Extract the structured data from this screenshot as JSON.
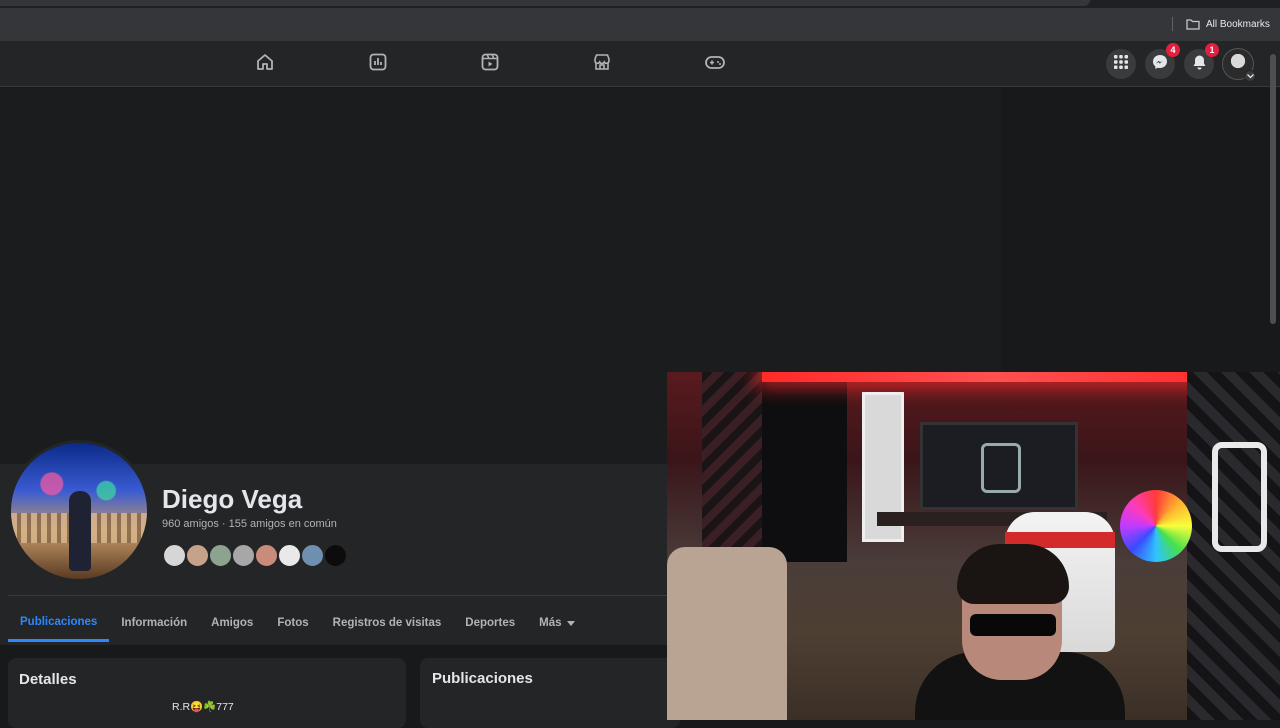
{
  "browser": {
    "bookmarks_label": "All Bookmarks"
  },
  "nav": {
    "tabs": [
      {
        "name": "home",
        "icon": "home-icon"
      },
      {
        "name": "dashboard",
        "icon": "dashboard-icon"
      },
      {
        "name": "video",
        "icon": "video-icon"
      },
      {
        "name": "marketplace",
        "icon": "marketplace-icon"
      },
      {
        "name": "gaming",
        "icon": "gaming-icon"
      }
    ],
    "messenger_badge": "4",
    "notifications_badge": "1"
  },
  "profile": {
    "name": "Diego Vega",
    "friends_line": "960 amigos · 155 amigos en común",
    "tabs": [
      "Publicaciones",
      "Información",
      "Amigos",
      "Fotos",
      "Registros de visitas",
      "Deportes",
      "Más"
    ],
    "active_tab": "Publicaciones",
    "details_title": "Detalles",
    "posts_title": "Publicaciones",
    "bio": "R.R😝☘️777"
  },
  "colors": {
    "accent": "#2d88ff",
    "badge": "#e41e3f",
    "surface": "#242526",
    "background": "#18191a"
  }
}
